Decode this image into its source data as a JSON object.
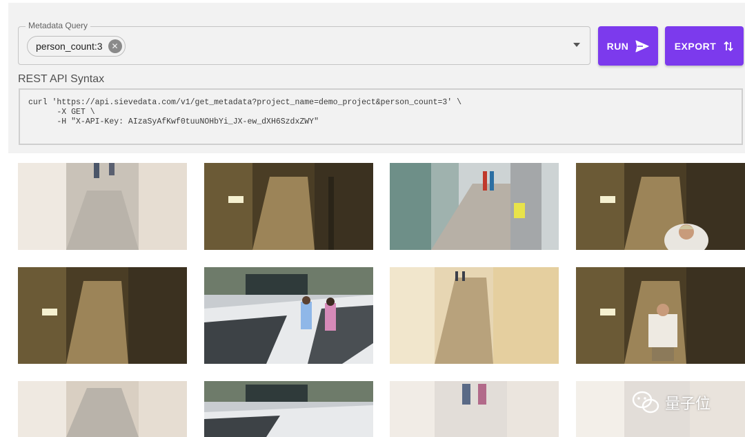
{
  "query": {
    "label": "Metadata Query",
    "chip": "person_count:3"
  },
  "buttons": {
    "run": "RUN",
    "export": "EXPORT"
  },
  "api": {
    "heading": "REST API Syntax",
    "lines": [
      "curl 'https://api.sievedata.com/v1/get_metadata?project_name=demo_project&person_count=3' \\",
      "      -X GET \\",
      "      -H \"X-API-Key: AIzaSyAfKwf0tuuNOHbYi_JX-ew_dXH6SzdxZWY\""
    ]
  },
  "watermark": {
    "text": "量子位",
    "icon": "wechat-icon"
  },
  "colors": {
    "accent": "#7c3aed",
    "panel_bg": "#f2f2f2"
  }
}
